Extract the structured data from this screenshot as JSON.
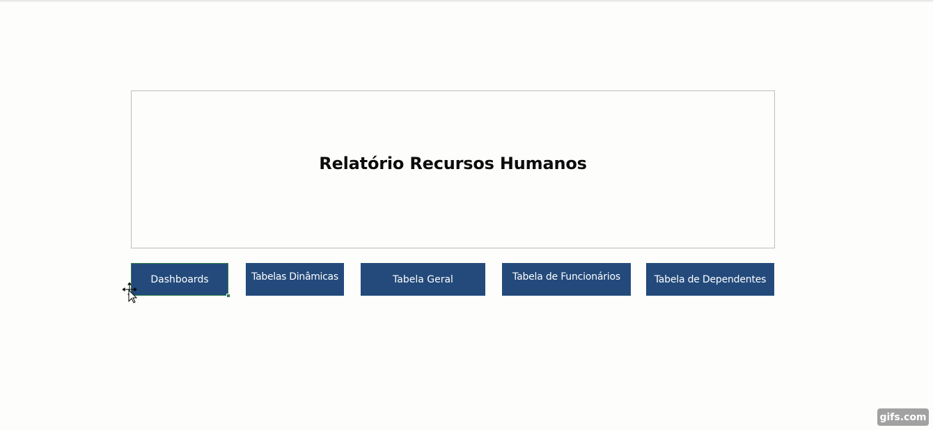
{
  "report": {
    "title": "Relatório Recursos Humanos"
  },
  "nav": {
    "dashboards": "Dashboards",
    "tabelas_dinamicas": "Tabelas Dinâmicas",
    "tabela_geral": "Tabela Geral",
    "tabela_funcionarios": "Tabela de Funcionários",
    "tabela_dependentes": "Tabela de Dependentes"
  },
  "colors": {
    "button_bg": "#234a7b",
    "button_text": "#ffffff",
    "selection_border": "#2e7d4f",
    "background": "#fdfdfb"
  },
  "cursor": {
    "icon": "move-cursor-icon"
  },
  "watermark": {
    "text": "gifs.com"
  }
}
